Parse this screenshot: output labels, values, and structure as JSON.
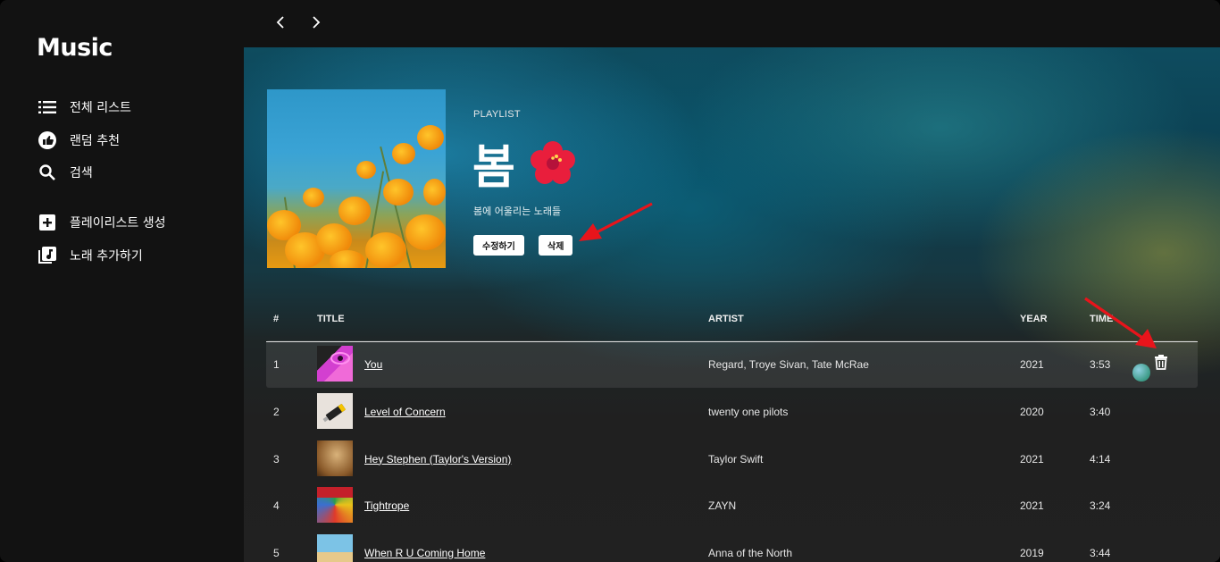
{
  "app": {
    "name": "Music"
  },
  "sidebar": {
    "items": [
      {
        "label": "전체 리스트",
        "icon": "list-icon"
      },
      {
        "label": "랜덤 추천",
        "icon": "thumb-up-icon"
      },
      {
        "label": "검색",
        "icon": "search-icon"
      },
      {
        "label": "플레이리스트 생성",
        "icon": "add-box-icon"
      },
      {
        "label": "노래 추가하기",
        "icon": "library-music-icon"
      }
    ]
  },
  "topbar": {
    "back": "‹",
    "forward": "›"
  },
  "playlist": {
    "type": "PLAYLIST",
    "title": "봄",
    "emoji_icon": "hibiscus-icon",
    "description": "봄에 어울리는 노래들",
    "edit_label": "수정하기",
    "delete_label": "삭제"
  },
  "table": {
    "headers": {
      "num": "#",
      "title": "TITLE",
      "artist": "ARTIST",
      "year": "YEAR",
      "time": "TIME"
    },
    "rows": [
      {
        "num": "1",
        "title": "You",
        "artist": "Regard, Troye Sivan, Tate McRae",
        "year": "2021",
        "time": "3:53"
      },
      {
        "num": "2",
        "title": "Level of Concern",
        "artist": "twenty one pilots",
        "year": "2020",
        "time": "3:40"
      },
      {
        "num": "3",
        "title": "Hey Stephen (Taylor's Version)",
        "artist": "Taylor Swift",
        "year": "2021",
        "time": "4:14"
      },
      {
        "num": "4",
        "title": "Tightrope",
        "artist": "ZAYN",
        "year": "2021",
        "time": "3:24"
      },
      {
        "num": "5",
        "title": "When R U Coming Home",
        "artist": "Anna of the North",
        "year": "2019",
        "time": "3:44"
      }
    ]
  },
  "colors": {
    "annotation_arrow": "#e8141b",
    "sidebar_bg": "#121212",
    "row_hover": "#3a3a3a"
  }
}
